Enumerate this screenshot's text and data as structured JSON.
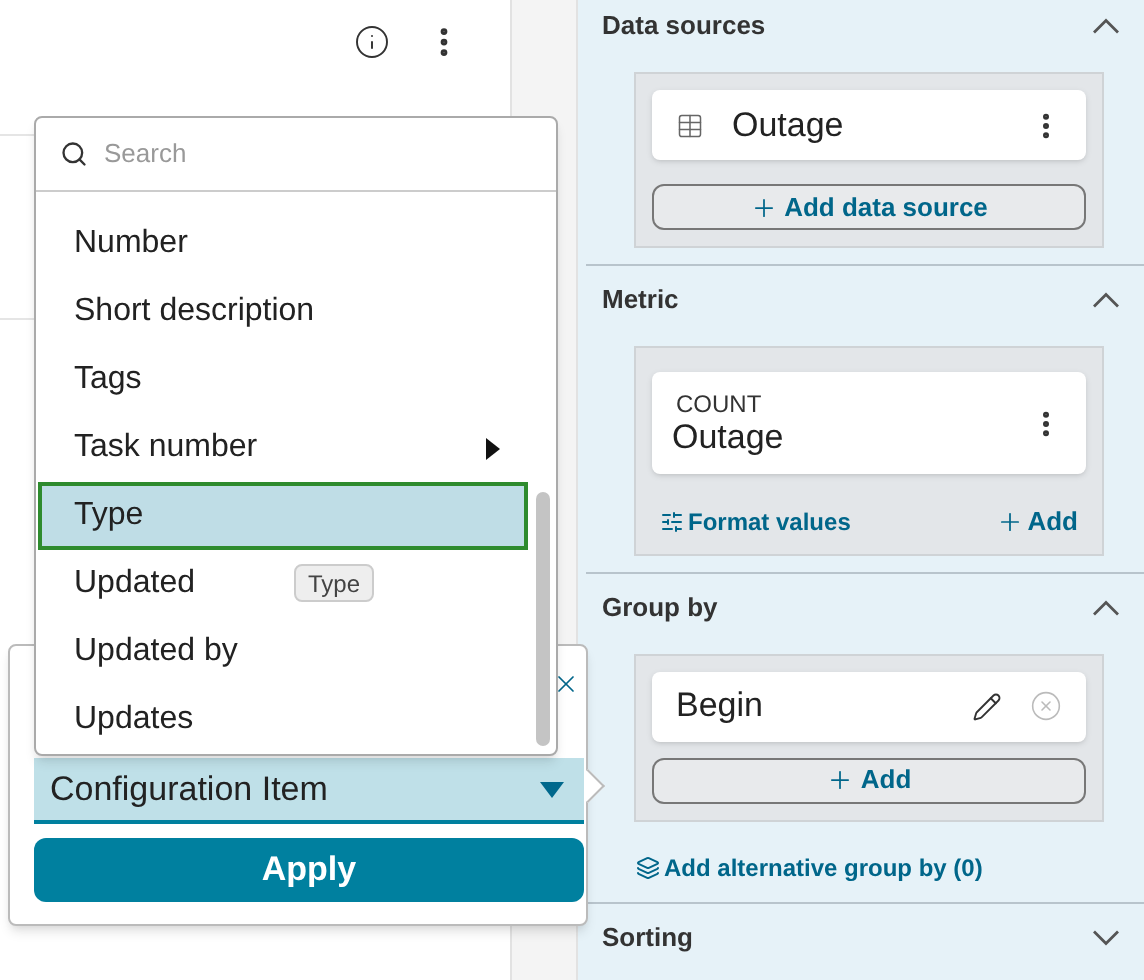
{
  "dropdown": {
    "search": {
      "placeholder": "Search"
    },
    "items": [
      {
        "label": "Number",
        "selected": false,
        "submenu": false
      },
      {
        "label": "Short description",
        "selected": false,
        "submenu": false
      },
      {
        "label": "Tags",
        "selected": false,
        "submenu": false
      },
      {
        "label": "Task number",
        "selected": false,
        "submenu": true
      },
      {
        "label": "Type",
        "selected": true,
        "submenu": false
      },
      {
        "label": "Updated",
        "selected": false,
        "submenu": false
      },
      {
        "label": "Updated by",
        "selected": false,
        "submenu": false
      },
      {
        "label": "Updates",
        "selected": false,
        "submenu": false
      }
    ]
  },
  "tooltip": "Type",
  "popover": {
    "select": {
      "value": "Configuration Item"
    },
    "apply": "Apply"
  },
  "data_sources": {
    "title": "Data sources",
    "expanded": true,
    "items": [
      {
        "name": "Outage"
      }
    ],
    "add": "Add data source"
  },
  "metric": {
    "title": "Metric",
    "expanded": true,
    "items": [
      {
        "aggregate": "COUNT",
        "name": "Outage"
      }
    ],
    "format": "Format values",
    "add": "Add"
  },
  "group_by": {
    "title": "Group by",
    "expanded": true,
    "items": [
      {
        "name": "Begin"
      }
    ],
    "add": "Add",
    "alternative": "Add alternative group by (0)"
  },
  "sorting": {
    "title": "Sorting",
    "expanded": false
  }
}
